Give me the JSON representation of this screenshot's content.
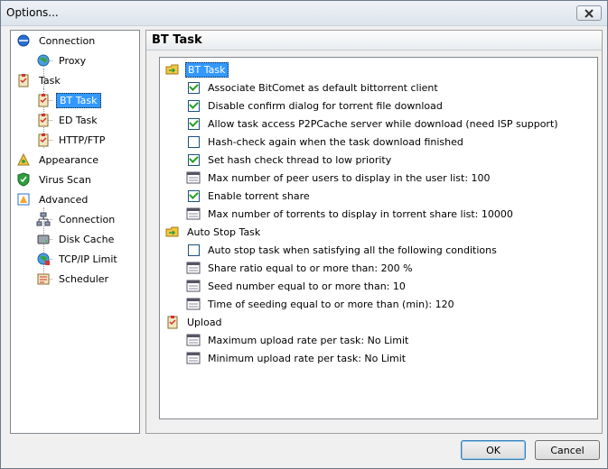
{
  "window": {
    "title": "Options..."
  },
  "tree": {
    "items": [
      {
        "label": "Connection",
        "icon": "connection-icon"
      },
      {
        "label": "Proxy",
        "icon": "proxy-globe-icon"
      },
      {
        "label": "Task",
        "icon": "task-clipboard-icon"
      },
      {
        "label": "BT Task",
        "icon": "task-clipboard-icon",
        "selected": true
      },
      {
        "label": "ED Task",
        "icon": "task-clipboard-icon"
      },
      {
        "label": "HTTP/FTP",
        "icon": "task-clipboard-icon"
      },
      {
        "label": "Appearance",
        "icon": "appearance-icon"
      },
      {
        "label": "Virus Scan",
        "icon": "shield-icon"
      },
      {
        "label": "Advanced",
        "icon": "advanced-icon"
      },
      {
        "label": "Connection",
        "icon": "network-icon"
      },
      {
        "label": "Disk Cache",
        "icon": "disk-icon"
      },
      {
        "label": "TCP/IP Limit",
        "icon": "globe-icon"
      },
      {
        "label": "Scheduler",
        "icon": "scheduler-icon"
      }
    ]
  },
  "panel": {
    "title": "BT Task"
  },
  "options": {
    "bt_group": "BT Task",
    "bt_items": [
      {
        "label": "Associate BitComet as default bittorrent client",
        "type": "checkbox",
        "checked": true
      },
      {
        "label": "Disable confirm dialog for torrent file download",
        "type": "checkbox",
        "checked": true
      },
      {
        "label": "Allow task access P2PCache server while download (need ISP support)",
        "type": "checkbox",
        "checked": true
      },
      {
        "label": "Hash-check again when the task download finished",
        "type": "checkbox",
        "checked": false
      },
      {
        "label": "Set hash check thread to low priority",
        "type": "checkbox",
        "checked": true
      },
      {
        "label": "Max number of peer users to display in the user list: 100",
        "type": "value"
      },
      {
        "label": "Enable torrent share",
        "type": "checkbox",
        "checked": true
      },
      {
        "label": "Max number of torrents to display in torrent share list: 10000",
        "type": "value"
      }
    ],
    "autostop_group": "Auto Stop Task",
    "autostop_items": [
      {
        "label": "Auto stop task when satisfying all the following conditions",
        "type": "checkbox",
        "checked": false
      },
      {
        "label": "Share ratio equal to or more than: 200 %",
        "type": "value"
      },
      {
        "label": "Seed number equal to or more than: 10",
        "type": "value"
      },
      {
        "label": "Time of seeding equal to or more than (min): 120",
        "type": "value"
      }
    ],
    "upload_group": "Upload",
    "upload_items": [
      {
        "label": "Maximum upload rate per task: No Limit",
        "type": "value"
      },
      {
        "label": "Minimum upload rate per task: No Limit",
        "type": "value"
      }
    ]
  },
  "buttons": {
    "ok": "OK",
    "cancel": "Cancel"
  },
  "colors": {
    "selection": "#3399ff",
    "check": "#21a121"
  }
}
